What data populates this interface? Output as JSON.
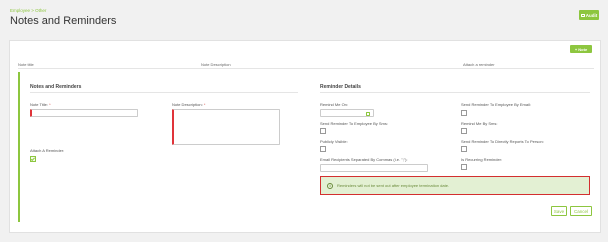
{
  "header": {
    "breadcrumb": "Employee > Other",
    "title": "Notes and Reminders",
    "audit_label": "Audit"
  },
  "toolbar": {
    "add_note_label": "+ Note"
  },
  "table": {
    "columns": [
      "Note title",
      "Note Description",
      "Attach a reminder"
    ]
  },
  "notes_section": {
    "title": "Notes and Reminders",
    "note_title_label": "Note Title:",
    "note_desc_label": "Note Description:",
    "required_mark": "*",
    "attach_label": "Attach A Reminder:",
    "attach_checked": true
  },
  "reminder_section": {
    "title": "Reminder Details",
    "remind_on_label": "Remind Me On:",
    "send_email_label": "Send Reminder To Employee By Email:",
    "send_sms_label": "Send Reminder To Employee By Sms:",
    "remind_sms_label": "Remind Me By Sms:",
    "public_label": "Publicly Visible:",
    "direct_reports_label": "Send Reminder To Directly Reports To Person:",
    "email_recipients_label": "Email Recipients Separated By Commas (i.e. \";\"):",
    "recurring_label": "Is Recurring Reminder:"
  },
  "notice": {
    "text": "Reminders will not be sent out after employee termination date."
  },
  "actions": {
    "save_label": "Save",
    "cancel_label": "Cancel"
  },
  "colors": {
    "accent": "#8dc63f",
    "error": "#d32f2f",
    "notice_bg": "#e3f0d3"
  }
}
